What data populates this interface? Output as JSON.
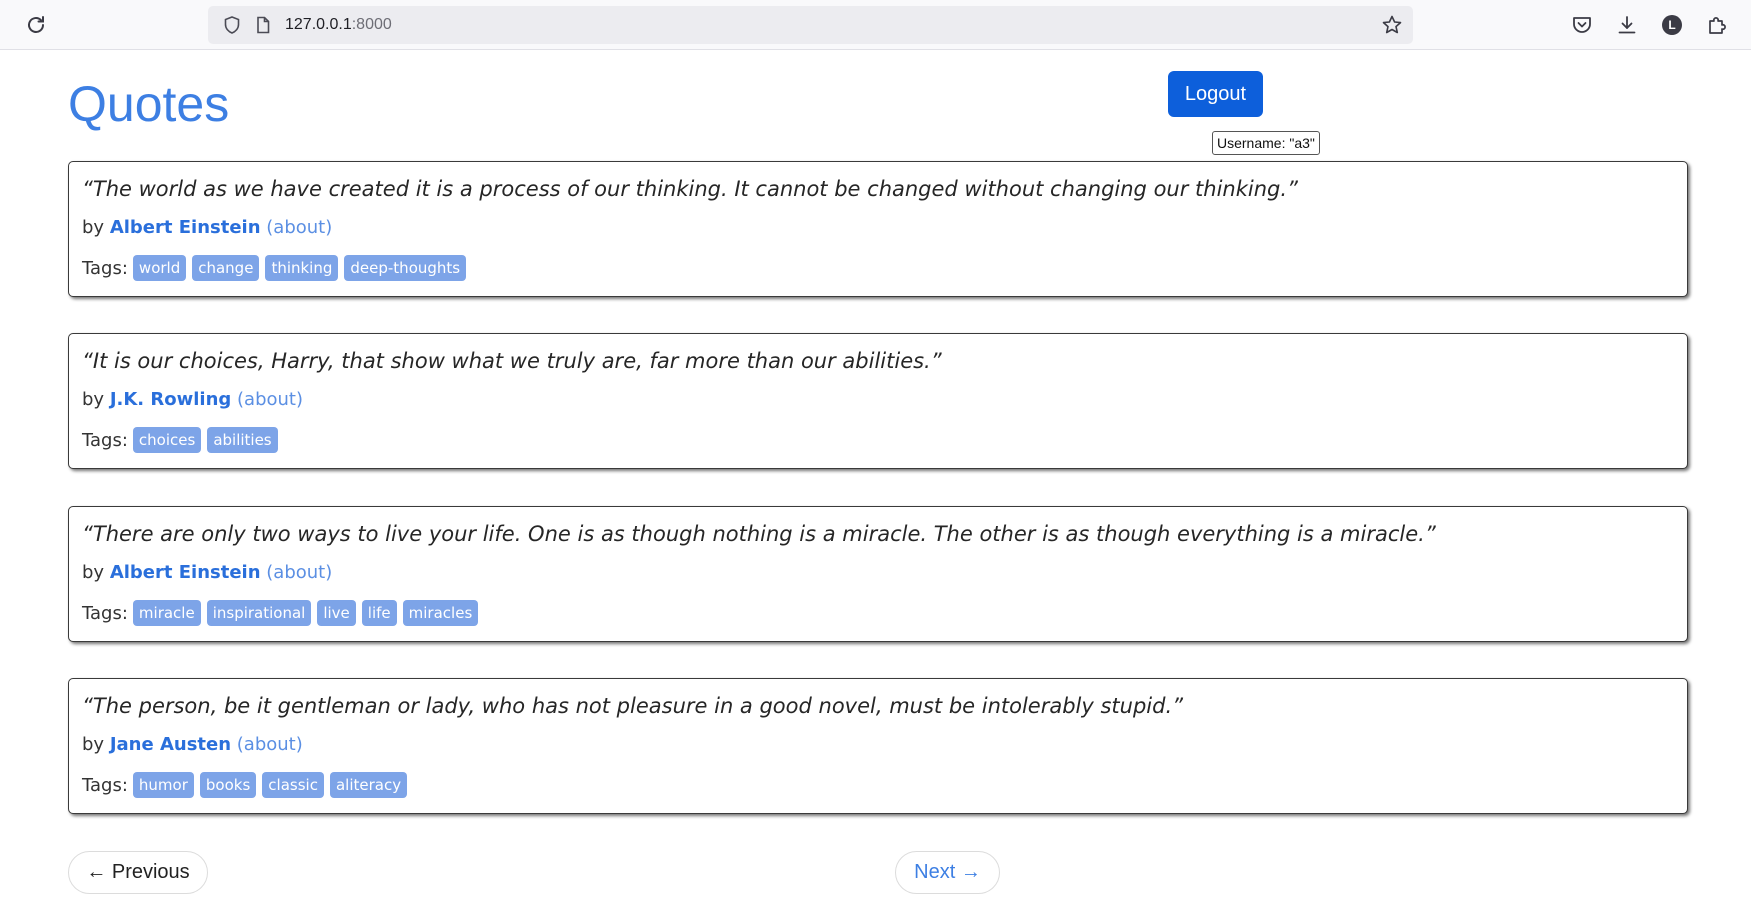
{
  "browser": {
    "url_host": "127.0.0.1",
    "url_port": ":8000"
  },
  "page": {
    "title": "Quotes",
    "logout_label": "Logout",
    "tooltip": "Username: \"a3\"",
    "tags_label": "Tags:",
    "by_label": "by",
    "about_label": "(about)"
  },
  "quotes": [
    {
      "text": "“The world as we have created it is a process of our thinking. It cannot be changed without changing our thinking.”",
      "author": "Albert Einstein",
      "tags": [
        "world",
        "change",
        "thinking",
        "deep-thoughts"
      ]
    },
    {
      "text": "“It is our choices, Harry, that show what we truly are, far more than our abilities.”",
      "author": "J.K. Rowling",
      "tags": [
        "choices",
        "abilities"
      ]
    },
    {
      "text": "“There are only two ways to live your life. One is as though nothing is a miracle. The other is as though everything is a miracle.”",
      "author": "Albert Einstein",
      "tags": [
        "miracle",
        "inspirational",
        "live",
        "life",
        "miracles"
      ]
    },
    {
      "text": "“The person, be it gentleman or lady, who has not pleasure in a good novel, must be intolerably stupid.”",
      "author": "Jane Austen",
      "tags": [
        "humor",
        "books",
        "classic",
        "aliteracy"
      ]
    }
  ],
  "pager": {
    "previous_label": "← Previous",
    "next_label": "Next →"
  },
  "colors": {
    "title": "#3d7fe3",
    "logout_bg": "#0d5fdb",
    "tag_bg": "#7da4e8",
    "author_link": "#2a6fdb"
  },
  "icons": {
    "reload": "reload-icon",
    "shield": "shield-icon",
    "page": "page-icon",
    "bookmark": "star-icon",
    "pocket": "pocket-icon",
    "downloads": "download-icon",
    "account": "account-icon",
    "extensions": "extensions-icon"
  }
}
